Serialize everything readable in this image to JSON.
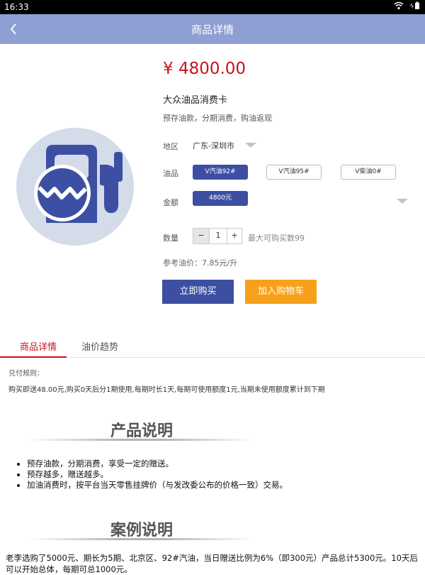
{
  "status_bar": {
    "time": "16:33",
    "icons": [
      "wifi-icon",
      "battery-icon"
    ]
  },
  "app_bar": {
    "title": "商品详情",
    "back_icon": "chevron-left-icon"
  },
  "product": {
    "price": "¥ 4800.00",
    "name": "大众油品消费卡",
    "description": "预存油款，分期消费，购油返现",
    "image_icon": "fuel-pump-icon"
  },
  "options": {
    "region_label": "地区",
    "region_value": "广东-深圳市",
    "fuel_label": "油品",
    "fuel_options": [
      "V汽油92#",
      "V汽油95#",
      "V柴油0#"
    ],
    "fuel_selected": 0,
    "amount_label": "金额",
    "amount_value": "4800元"
  },
  "quantity": {
    "label": "数量",
    "minus": "−",
    "value": "1",
    "plus": "+",
    "max_text": "最大可购买数99"
  },
  "ref_price": "参考油价：7.85元/升",
  "buttons": {
    "buy_now": "立即购买",
    "add_cart": "加入购物车"
  },
  "tabs": [
    {
      "label": "商品详情",
      "active": true
    },
    {
      "label": "油价趋势",
      "active": false
    }
  ],
  "rules": {
    "title": "兑付规则：",
    "text": "购买即送48.00元,购买0天后分1期使用,每期时长1天,每期可使用额度1元,当期未使用额度累计到下期"
  },
  "product_info": {
    "title": "产品说明",
    "bullets": [
      "预存油款，分期消费，享受一定的赠送。",
      "预存越多，赠送越多。",
      "加油消费时，按平台当天零售挂牌价（与发改委公布的价格一致）交易。"
    ]
  },
  "case_info": {
    "title": "案例说明",
    "text": "老李选购了5000元、期长为5期、北京区、92#汽油，当日赠送比例为6%（即300元）产品总计5300元。10天后可以开始总体，每期可总1000元。"
  },
  "colors": {
    "app_bar": "#8e9fd3",
    "primary": "#3d4fa3",
    "accent": "#f7a11a",
    "price": "#c9131a"
  }
}
